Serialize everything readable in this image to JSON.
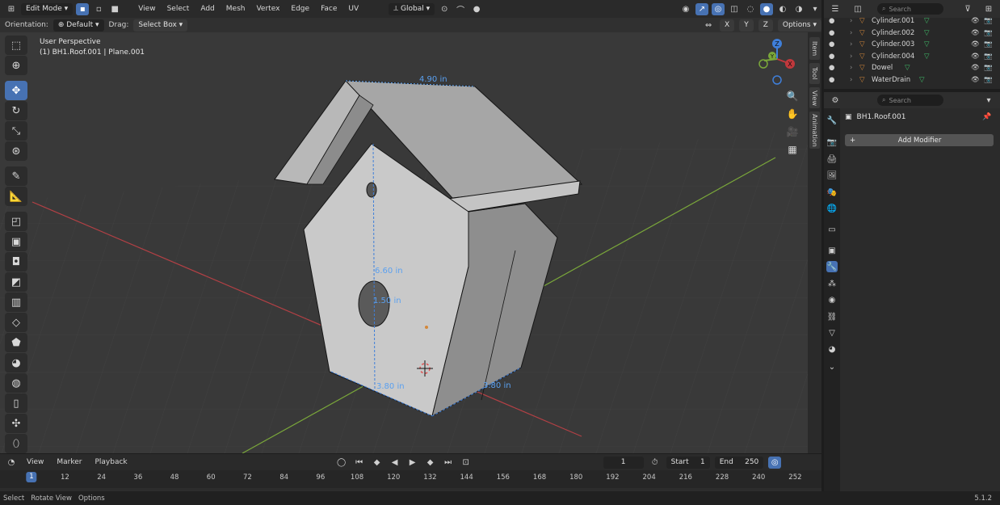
{
  "topbar": {
    "mode": "Edit Mode",
    "menus": [
      "View",
      "Select",
      "Add",
      "Mesh",
      "Vertex",
      "Edge",
      "Face",
      "UV"
    ],
    "transform_orientation": "Global"
  },
  "header2": {
    "orientation_label": "Orientation:",
    "orientation_value": "Default",
    "drag_label": "Drag:",
    "drag_value": "Select Box",
    "options_label": "Options",
    "axes": [
      "X",
      "Y",
      "Z"
    ]
  },
  "viewport": {
    "view_name": "User Perspective",
    "object_info": "(1) BH1.Roof.001 | Plane.001",
    "measurements": [
      "4.90 in",
      "6.60 in",
      "1.50 in",
      "3.80 in",
      "3.80 in"
    ],
    "gizmo_axes": [
      "Z",
      "Y",
      "X"
    ]
  },
  "side_tabs": [
    "Item",
    "Tool",
    "View",
    "Animation"
  ],
  "timeline": {
    "menus": [
      "View",
      "Marker",
      "Playback"
    ],
    "current_frame": "1",
    "start_label": "Start",
    "start_value": "1",
    "end_label": "End",
    "end_value": "250",
    "ruler": [
      "1",
      "12",
      "24",
      "36",
      "48",
      "60",
      "72",
      "84",
      "96",
      "108",
      "120",
      "132",
      "144",
      "156",
      "168",
      "180",
      "192",
      "204",
      "216",
      "228",
      "240",
      "252"
    ]
  },
  "outliner": {
    "search_placeholder": "Search",
    "items": [
      "Cylinder.001",
      "Cylinder.002",
      "Cylinder.003",
      "Cylinder.004",
      "Dowel",
      "WaterDrain"
    ]
  },
  "properties": {
    "search_placeholder": "Search",
    "object_name": "BH1.Roof.001",
    "add_modifier": "Add Modifier"
  },
  "statusbar": {
    "select": "Select",
    "rotate": "Rotate View",
    "options": "Options",
    "version": "5.1.2"
  },
  "colors": {
    "accent": "#4772b3",
    "x_axis": "#c0383c",
    "y_axis": "#7aa73a",
    "z_axis": "#3f7fd9",
    "measure": "#5aa0f0",
    "object_orange": "#d4873a",
    "mesh_green": "#3fbf6a"
  }
}
